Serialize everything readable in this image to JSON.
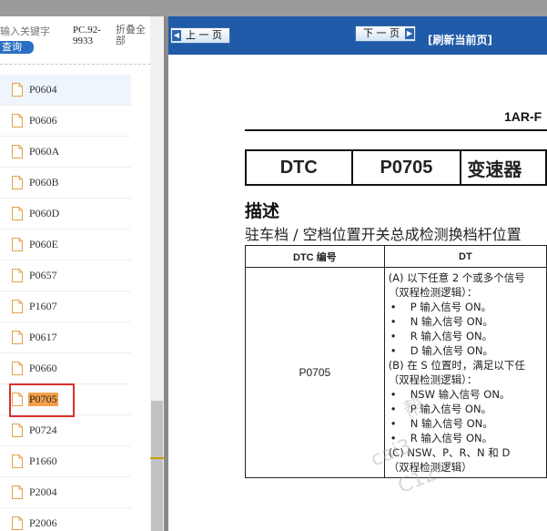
{
  "search": {
    "placeholder": "输入关键字",
    "button": "查询"
  },
  "sidebar": {
    "model": "PC.92-9933",
    "collapse_all": "折叠全部",
    "items": [
      {
        "label": "P0604"
      },
      {
        "label": "P0606"
      },
      {
        "label": "P060A"
      },
      {
        "label": "P060B"
      },
      {
        "label": "P060D"
      },
      {
        "label": "P060E"
      },
      {
        "label": "P0657"
      },
      {
        "label": "P1607"
      },
      {
        "label": "P0617"
      },
      {
        "label": "P0660"
      },
      {
        "label": "P0705"
      },
      {
        "label": "P0724"
      },
      {
        "label": "P1660"
      },
      {
        "label": "P2004"
      },
      {
        "label": "P2006"
      }
    ],
    "selected": "P0705"
  },
  "toolbar": {
    "prev": "上 一 页",
    "next": "下 一 页",
    "refresh": "[刷新当前页]"
  },
  "document": {
    "engine": "1AR-F",
    "dtc_label": "DTC",
    "dtc_code": "P0705",
    "dtc_title": "变速器",
    "section": "描述",
    "description": "驻车档 / 空档位置开关总成检测换档杆位置",
    "table_header_code": "DTC 编号",
    "table_header_cond": "DT",
    "code_cell": "P0705",
    "lines": {
      "a": "(A) 以下任意 2 个或多个信号",
      "a_logic": "（双程检测逻辑）：",
      "a1": "P 输入信号 ON。",
      "a2": "N 输入信号 ON。",
      "a3": "R 输入信号 ON。",
      "a4": "D 输入信号 ON。",
      "b": "(B) 在 S 位置时，满足以下任",
      "b_logic": "（双程检测逻辑）：",
      "b1": "NSW 输入信号 ON。",
      "b2": "P 输入信号 ON。",
      "b3": "N 输入信号 ON。",
      "b4": "R 输入信号 ON。",
      "c": "(C) NSW、P、R、N 和 D",
      "c_logic": "（双程检测逻辑）"
    },
    "bullet": "•"
  },
  "watermarks": [
    "帮",
    "cai3",
    "C12"
  ],
  "colors": {
    "toolbar": "#1f5ba8",
    "highlight": "#f4a04a",
    "selection_box": "#d9302a",
    "search_button": "#2b6fc2"
  }
}
